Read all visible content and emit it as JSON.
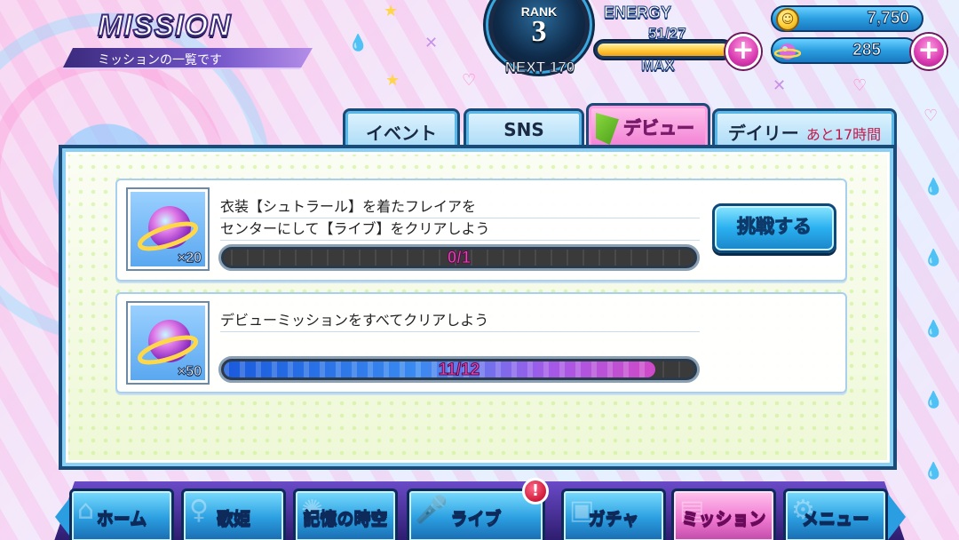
{
  "header": {
    "title": "MISSION",
    "subtitle": "ミッションの一覧です"
  },
  "rank": {
    "label": "RANK",
    "value": "3",
    "next": "NEXT 170"
  },
  "energy": {
    "label": "ENERGY",
    "value": "51/27",
    "status": "MAX",
    "fill_fraction": 1.0,
    "add_icon": "plus-icon"
  },
  "currency": {
    "coins": "7,750",
    "coin_icon": "coin-icon",
    "gems": "285",
    "gem_icon": "planet-gem-icon"
  },
  "tabs": [
    {
      "label": "イベント",
      "active": false
    },
    {
      "label": "SNS",
      "active": false
    },
    {
      "label": "デビュー",
      "active": true
    },
    {
      "label": "デイリー",
      "note": "あと17時間",
      "active": false
    }
  ],
  "missions": [
    {
      "line1": "衣装【シュトラール】を着たフレイアを",
      "line2": "センターにして【ライブ】をクリアしよう",
      "reward_qty": "×20",
      "progress_text": "0/1",
      "progress_fraction": 0.0,
      "button_label": "挑戦する"
    },
    {
      "line1": "デビューミッションをすべてクリアしよう",
      "line2": "",
      "reward_qty": "×50",
      "progress_text": "11/12",
      "progress_fraction": 0.9167
    }
  ],
  "nav": [
    {
      "label": "ホーム",
      "icon": "home-icon"
    },
    {
      "label": "歌姫",
      "icon": "singer-icon"
    },
    {
      "label": "記憶の時空",
      "icon": "galaxy-icon"
    },
    {
      "label": "ライブ",
      "icon": "microphone-icon",
      "alert": "!"
    },
    {
      "label": "ガチャ",
      "icon": "ticket-icon"
    },
    {
      "label": "ミッション",
      "icon": "document-icon",
      "active": true
    },
    {
      "label": "メニュー",
      "icon": "gear-icon"
    }
  ],
  "colors": {
    "accent_pink": "#f07ad2",
    "accent_blue": "#2a9ee0",
    "frame_navy": "#1a4a78"
  }
}
